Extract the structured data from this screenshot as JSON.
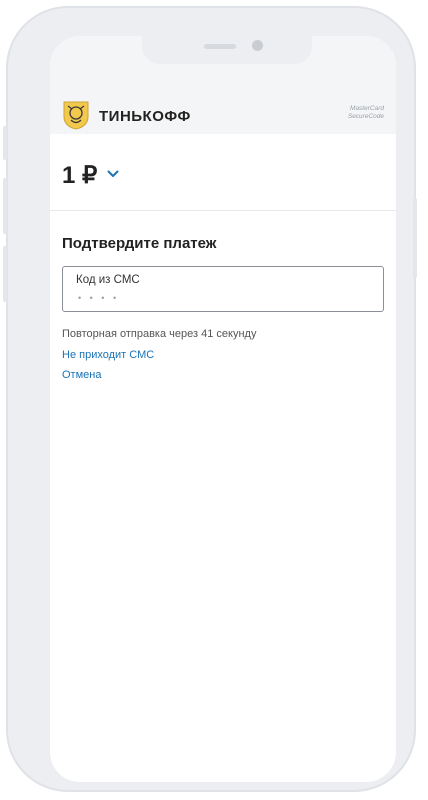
{
  "brand": {
    "name": "ТИНЬКОФФ",
    "logo": "tinkoff-emblem-icon"
  },
  "secure_badge": {
    "line1": "MasterCard",
    "line2": "SecureCode"
  },
  "payment": {
    "amount": "1 ₽",
    "expand_icon": "chevron-down-icon"
  },
  "confirm": {
    "title": "Подтвердите платеж",
    "field_label": "Код из СМС",
    "field_value": "• • • •",
    "resend_text": "Повторная отправка через 41 секунду",
    "no_sms_link": "Не приходит СМС",
    "cancel_link": "Отмена"
  },
  "colors": {
    "link": "#1a73b4",
    "frame": "#eceef1",
    "accent_logo": "#f2c94c"
  }
}
